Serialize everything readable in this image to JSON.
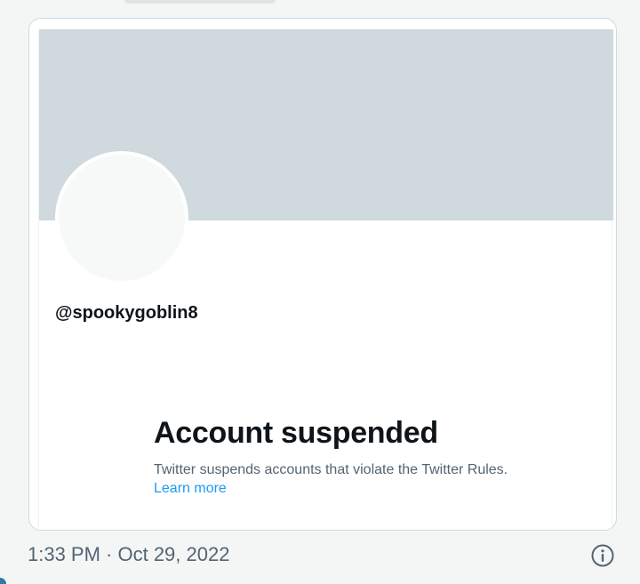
{
  "card": {
    "handle": "@spookygoblin8",
    "headline": "Account suspended",
    "description": "Twitter suspends accounts that violate the Twitter Rules.",
    "learn_more_label": "Learn more"
  },
  "footer": {
    "timestamp": "1:33 PM · Oct 29, 2022",
    "info_icon": "info-circle-icon"
  },
  "colors": {
    "banner": "#cfd9de",
    "link": "#1d9bf0",
    "text_primary": "#0f1419",
    "text_secondary": "#536471"
  }
}
